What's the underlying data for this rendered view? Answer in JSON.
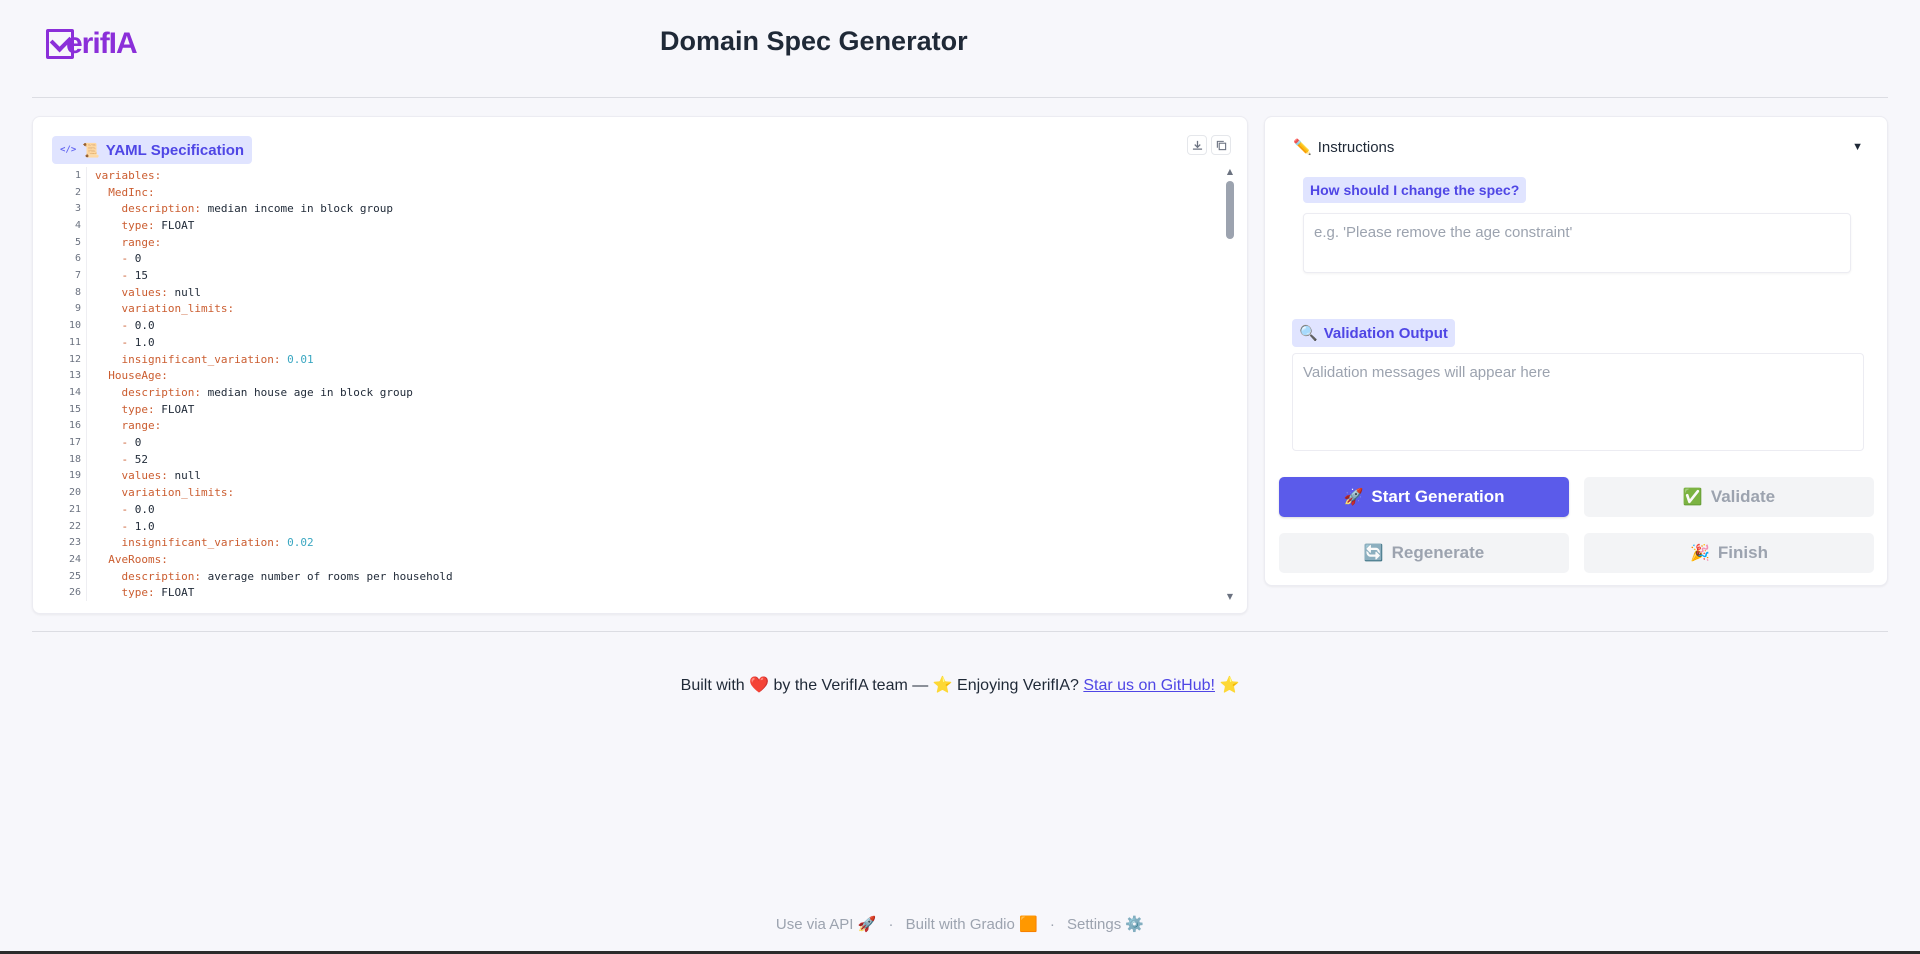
{
  "header": {
    "logo_text": "erifIA",
    "title": "Domain Spec Generator"
  },
  "yaml_panel": {
    "label": "YAML Specification",
    "code_icon": "</>",
    "scroll_icon": "📜",
    "actions": [
      "download-icon",
      "copy-icon"
    ],
    "lines": [
      {
        "n": "1",
        "t": [
          [
            "k",
            "variables:"
          ]
        ]
      },
      {
        "n": "2",
        "t": [
          [
            "s",
            "  "
          ],
          [
            "k",
            "MedInc:"
          ]
        ]
      },
      {
        "n": "3",
        "t": [
          [
            "s",
            "    "
          ],
          [
            "k",
            "description:"
          ],
          [
            "s",
            " median income in block group"
          ]
        ]
      },
      {
        "n": "4",
        "t": [
          [
            "s",
            "    "
          ],
          [
            "k",
            "type:"
          ],
          [
            "s",
            " FLOAT"
          ]
        ]
      },
      {
        "n": "5",
        "t": [
          [
            "s",
            "    "
          ],
          [
            "k",
            "range:"
          ]
        ]
      },
      {
        "n": "6",
        "t": [
          [
            "s",
            "    "
          ],
          [
            "k",
            "-"
          ],
          [
            "s",
            " 0"
          ]
        ]
      },
      {
        "n": "7",
        "t": [
          [
            "s",
            "    "
          ],
          [
            "k",
            "-"
          ],
          [
            "s",
            " 15"
          ]
        ]
      },
      {
        "n": "8",
        "t": [
          [
            "s",
            "    "
          ],
          [
            "k",
            "values:"
          ],
          [
            "s",
            " null"
          ]
        ]
      },
      {
        "n": "9",
        "t": [
          [
            "s",
            "    "
          ],
          [
            "k",
            "variation_limits:"
          ]
        ]
      },
      {
        "n": "10",
        "t": [
          [
            "s",
            "    "
          ],
          [
            "k",
            "-"
          ],
          [
            "s",
            " 0.0"
          ]
        ]
      },
      {
        "n": "11",
        "t": [
          [
            "s",
            "    "
          ],
          [
            "k",
            "-"
          ],
          [
            "s",
            " 1.0"
          ]
        ]
      },
      {
        "n": "12",
        "t": [
          [
            "s",
            "    "
          ],
          [
            "k",
            "insignificant_variation:"
          ],
          [
            "n",
            " 0.01"
          ]
        ]
      },
      {
        "n": "13",
        "t": [
          [
            "s",
            "  "
          ],
          [
            "k",
            "HouseAge:"
          ]
        ]
      },
      {
        "n": "14",
        "t": [
          [
            "s",
            "    "
          ],
          [
            "k",
            "description:"
          ],
          [
            "s",
            " median house age in block group"
          ]
        ]
      },
      {
        "n": "15",
        "t": [
          [
            "s",
            "    "
          ],
          [
            "k",
            "type:"
          ],
          [
            "s",
            " FLOAT"
          ]
        ]
      },
      {
        "n": "16",
        "t": [
          [
            "s",
            "    "
          ],
          [
            "k",
            "range:"
          ]
        ]
      },
      {
        "n": "17",
        "t": [
          [
            "s",
            "    "
          ],
          [
            "k",
            "-"
          ],
          [
            "s",
            " 0"
          ]
        ]
      },
      {
        "n": "18",
        "t": [
          [
            "s",
            "    "
          ],
          [
            "k",
            "-"
          ],
          [
            "s",
            " 52"
          ]
        ]
      },
      {
        "n": "19",
        "t": [
          [
            "s",
            "    "
          ],
          [
            "k",
            "values:"
          ],
          [
            "s",
            " null"
          ]
        ]
      },
      {
        "n": "20",
        "t": [
          [
            "s",
            "    "
          ],
          [
            "k",
            "variation_limits:"
          ]
        ]
      },
      {
        "n": "21",
        "t": [
          [
            "s",
            "    "
          ],
          [
            "k",
            "-"
          ],
          [
            "s",
            " 0.0"
          ]
        ]
      },
      {
        "n": "22",
        "t": [
          [
            "s",
            "    "
          ],
          [
            "k",
            "-"
          ],
          [
            "s",
            " 1.0"
          ]
        ]
      },
      {
        "n": "23",
        "t": [
          [
            "s",
            "    "
          ],
          [
            "k",
            "insignificant_variation:"
          ],
          [
            "n",
            " 0.02"
          ]
        ]
      },
      {
        "n": "24",
        "t": [
          [
            "s",
            "  "
          ],
          [
            "k",
            "AveRooms:"
          ]
        ]
      },
      {
        "n": "25",
        "t": [
          [
            "s",
            "    "
          ],
          [
            "k",
            "description:"
          ],
          [
            "s",
            " average number of rooms per household"
          ]
        ]
      },
      {
        "n": "26",
        "t": [
          [
            "s",
            "    "
          ],
          [
            "k",
            "type:"
          ],
          [
            "s",
            " FLOAT"
          ]
        ]
      }
    ]
  },
  "instructions": {
    "toggle_label": "Instructions",
    "toggle_icon": "✏️",
    "caret": "▼",
    "question_label": "How should I change the spec?",
    "input_placeholder": "e.g. 'Please remove the age constraint'",
    "validation_label": "Validation Output",
    "validation_icon": "🔍",
    "validation_placeholder": "Validation messages will appear here"
  },
  "buttons": {
    "start": {
      "label": "Start Generation",
      "icon": "🚀"
    },
    "validate": {
      "label": "Validate",
      "icon": "✅"
    },
    "regenerate": {
      "label": "Regenerate",
      "icon": "🔄"
    },
    "finish": {
      "label": "Finish",
      "icon": "🎉"
    }
  },
  "footer": {
    "credit_prefix": "Built with",
    "heart": "❤️",
    "credit_middle": "by the VerifIA team — ⭐ Enjoying VerifIA?",
    "github_link": "Star us on GitHub!",
    "star": "⭐",
    "use_api": "Use via API",
    "use_api_icon": "🚀",
    "built_gradio": "Built with Gradio",
    "gradio_icon": "🟧",
    "settings": "Settings",
    "settings_icon": "⚙️",
    "separator": "·"
  },
  "colors": {
    "accent": "#5b5bea",
    "label_bg": "#e0e4ff",
    "logo": "#8b2fd9"
  }
}
